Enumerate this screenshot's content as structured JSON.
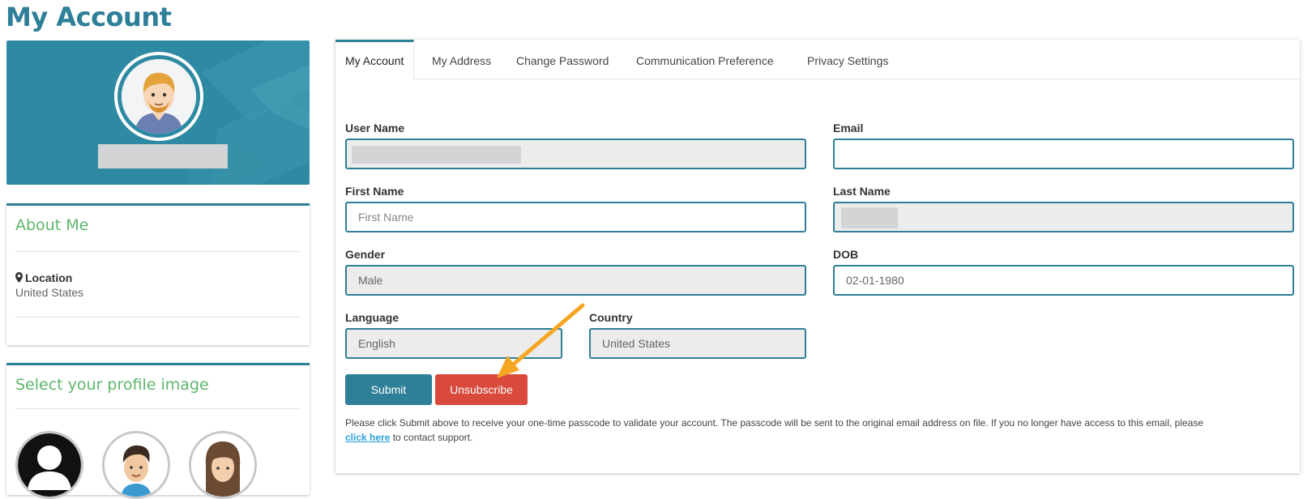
{
  "page": {
    "title": "My Account"
  },
  "about": {
    "title": "About Me",
    "location_label": "Location",
    "location_value": "United States"
  },
  "profile_images": {
    "title": "Select your profile image"
  },
  "tabs": [
    {
      "label": "My Account",
      "active": true
    },
    {
      "label": "My Address"
    },
    {
      "label": "Change Password"
    },
    {
      "label": "Communication Preference"
    },
    {
      "label": "Privacy Settings"
    }
  ],
  "form": {
    "username": {
      "label": "User Name",
      "value": ""
    },
    "email": {
      "label": "Email",
      "value": ""
    },
    "first_name": {
      "label": "First Name",
      "placeholder": "First Name",
      "value": ""
    },
    "last_name": {
      "label": "Last Name",
      "value": ""
    },
    "gender": {
      "label": "Gender",
      "value": "Male"
    },
    "dob": {
      "label": "DOB",
      "value": "02-01-1980"
    },
    "language": {
      "label": "Language",
      "value": "English"
    },
    "country": {
      "label": "Country",
      "value": "United States"
    }
  },
  "buttons": {
    "submit": "Submit",
    "unsubscribe": "Unsubscribe"
  },
  "note": {
    "text": "Please click Submit above to receive your one-time passcode to validate your account. The passcode will be sent to the original email address on file. If you no longer have access to this email, please",
    "link": "click here",
    "suffix": " to contact support."
  },
  "colors": {
    "primary": "#2e7f98",
    "accent_green": "#5db66b",
    "danger": "#d9493c",
    "annotation_arrow": "#f5a623"
  }
}
